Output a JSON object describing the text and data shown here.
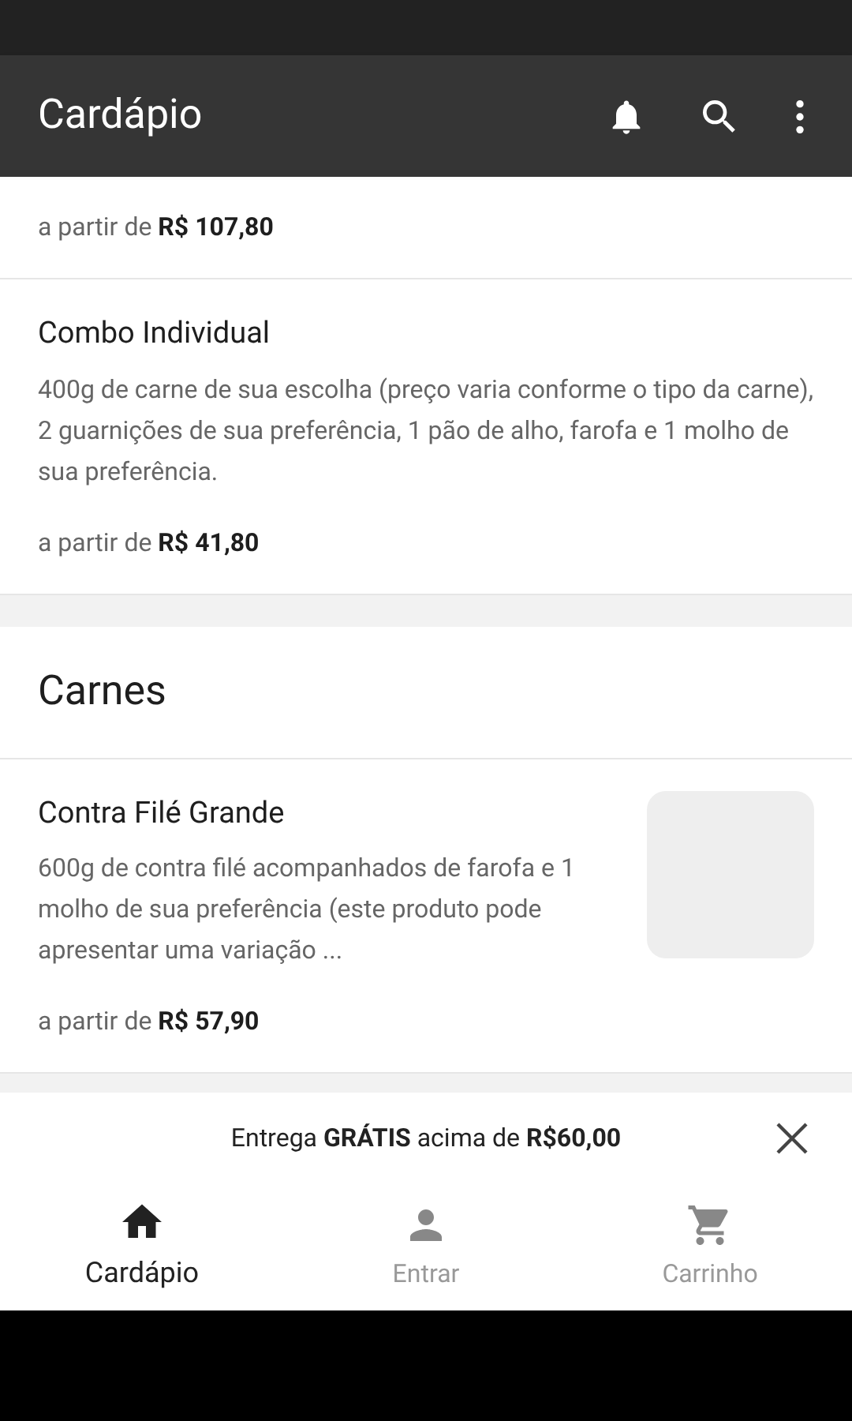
{
  "app_bar": {
    "title": "Cardápio"
  },
  "sections": [
    {
      "kind": "items",
      "items": [
        {
          "price_prefix": "a partir de",
          "price": "R$ 107,80",
          "has_image": false
        },
        {
          "name": "Combo Individual",
          "description": "400g de carne de sua escolha (preço varia conforme o tipo da carne), 2 guarnições de sua preferência, 1 pão de alho, farofa e 1 molho de sua preferência.",
          "price_prefix": "a partir de",
          "price": "R$ 41,80",
          "has_image": false
        }
      ]
    },
    {
      "kind": "header",
      "title": "Carnes"
    },
    {
      "kind": "items",
      "items": [
        {
          "name": "Contra Filé Grande",
          "description": "600g de contra filé acompanhados de farofa e 1 molho de sua preferência (este produto pode apresentar uma variação ...",
          "price_prefix": "a partir de",
          "price": "R$ 57,90",
          "has_image": true
        }
      ]
    }
  ],
  "banner": {
    "text": "Entrega **GRÁTIS** acima de **R$60,00**"
  },
  "bottom_nav": [
    {
      "label": "Cardápio",
      "kind": "home",
      "selected": true
    },
    {
      "label": "Entrar",
      "kind": "person",
      "selected": false
    },
    {
      "label": "Carrinho",
      "kind": "cart",
      "selected": false
    }
  ]
}
